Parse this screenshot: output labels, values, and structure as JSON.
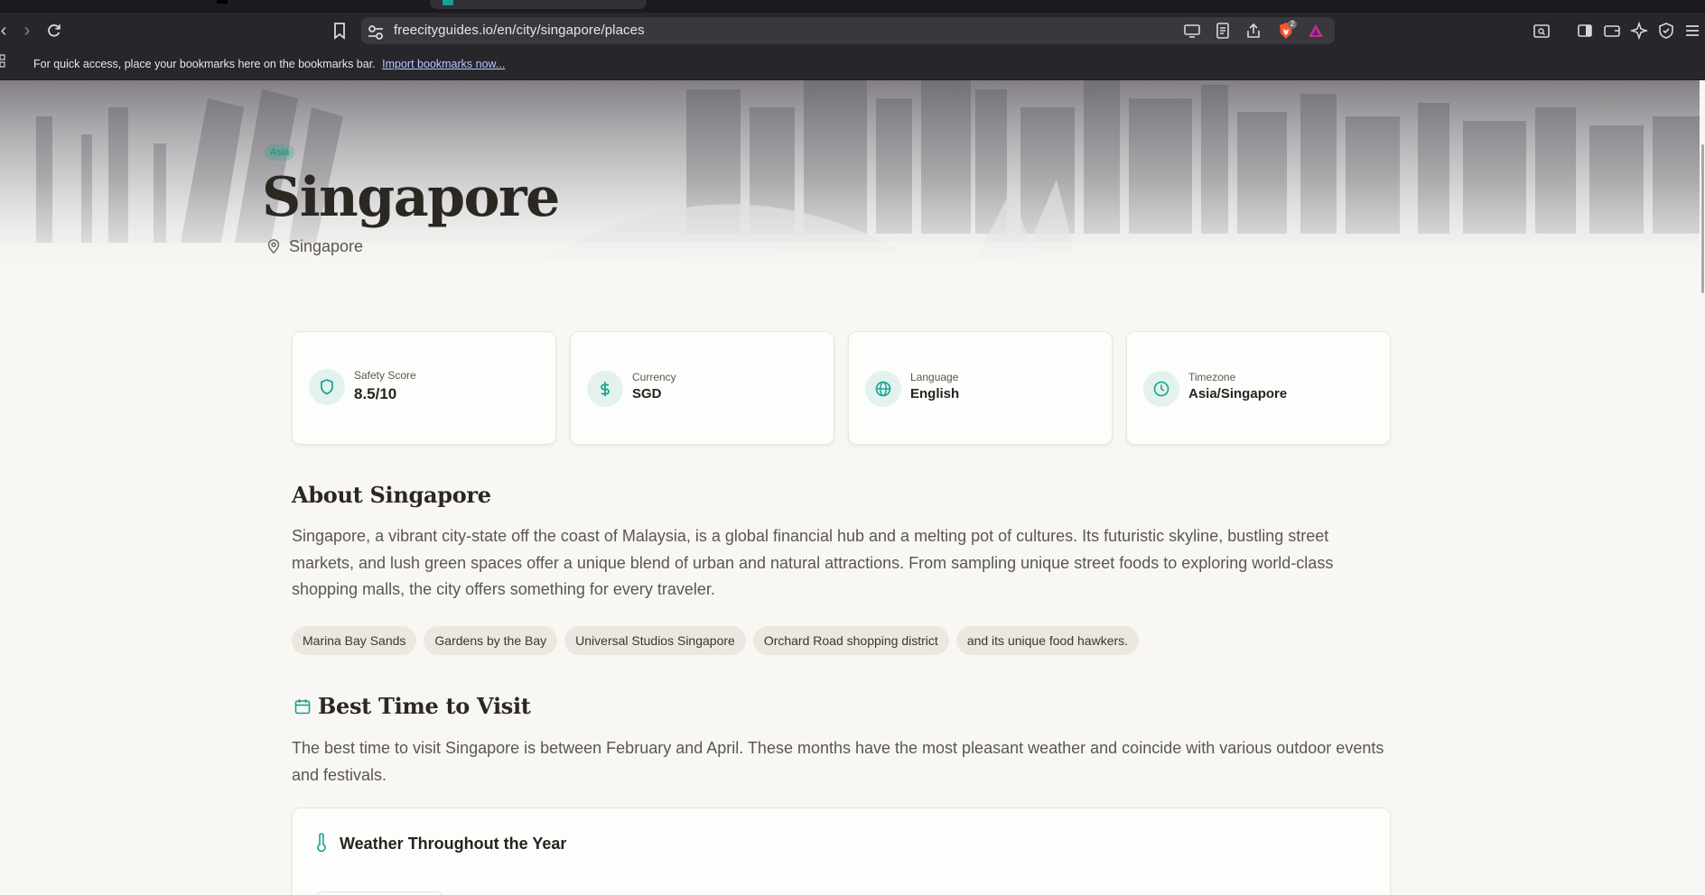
{
  "browser": {
    "url": "freecityguides.io/en/city/singapore/places",
    "bookmarks_bar": {
      "message": "For quick access, place your bookmarks here on the bookmarks bar.",
      "link": "Import bookmarks now..."
    },
    "extensions_badge": "2"
  },
  "hero": {
    "region": "Asia",
    "city": "Singapore",
    "country": "Singapore"
  },
  "info_cards": [
    {
      "label": "Safety Score",
      "value": "8.5/10",
      "icon": "shield-icon"
    },
    {
      "label": "Currency",
      "value": "SGD",
      "icon": "dollar-icon"
    },
    {
      "label": "Language",
      "value": "English",
      "icon": "globe-icon"
    },
    {
      "label": "Timezone",
      "value": "Asia/Singapore",
      "icon": "clock-icon"
    }
  ],
  "about": {
    "title": "About Singapore",
    "text": "Singapore, a vibrant city-state off the coast of Malaysia, is a global financial hub and a melting pot of cultures. Its futuristic skyline, bustling street markets, and lush green spaces offer a unique blend of urban and natural attractions. From sampling unique street foods to exploring world-class shopping malls, the city offers something for every traveler.",
    "highlights": [
      "Marina Bay Sands",
      "Gardens by the Bay",
      "Universal Studios Singapore",
      "Orchard Road shopping district",
      "and its unique food hawkers."
    ]
  },
  "best_time": {
    "title": "Best Time to Visit",
    "text": "The best time to visit Singapore is between February and April. These months have the most pleasant weather and coincide with various outdoor events and festivals."
  },
  "weather": {
    "title": "Weather Throughout the Year"
  },
  "colors": {
    "accent": "#13a38f",
    "background": "#f8f7f4",
    "chrome": "#26262b"
  }
}
